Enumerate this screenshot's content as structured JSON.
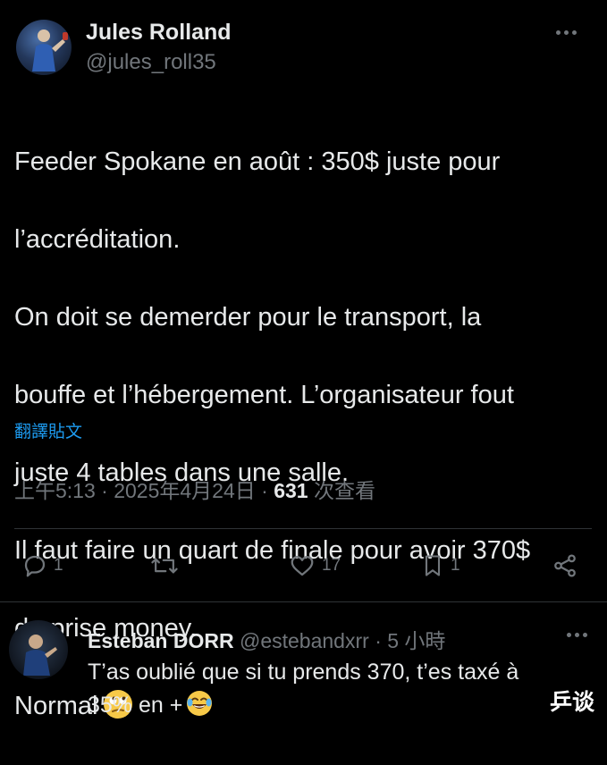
{
  "tweet": {
    "author_name": "Jules Rolland",
    "author_handle": "@jules_roll35",
    "text_lines": [
      "Feeder Spokane en août : 350$ juste pour",
      "l’accréditation.",
      "On doit se demerder pour le transport, la",
      "bouffe et l’hébergement. L’organisateur fout",
      "juste 4 tables dans une salle.",
      "Il faut faire un quart de finale pour avoir 370$",
      "de prise money.",
      "Normal"
    ],
    "trailing_emoji": "face-with-rolling-eyes-emoji",
    "translate_label": "翻譯貼文",
    "time": "上午5:13",
    "date": "2025年4月24日",
    "views_count": "631",
    "views_label": "次查看",
    "more_icon": "more-dots-icon"
  },
  "actions": {
    "reply_count": "1",
    "retweet_count": "",
    "like_count": "17",
    "bookmark_count": "1",
    "icons": [
      "reply-icon",
      "retweet-icon",
      "like-icon",
      "bookmark-icon",
      "share-icon"
    ]
  },
  "reply": {
    "author_name": "Esteban DORR",
    "author_handle": "@estebandxrr",
    "time_ago": "5 小時",
    "text_lines": [
      "T’as oublié que si tu prends 370, t’es taxé à",
      "35% en +"
    ],
    "trailing_emoji": "tears-of-joy-emoji"
  },
  "watermark": "乒谈",
  "colors": {
    "background": "#000000",
    "text": "#e7e9ea",
    "secondary": "#71767b",
    "link": "#1d9bf0",
    "divider": "#2f3336"
  }
}
